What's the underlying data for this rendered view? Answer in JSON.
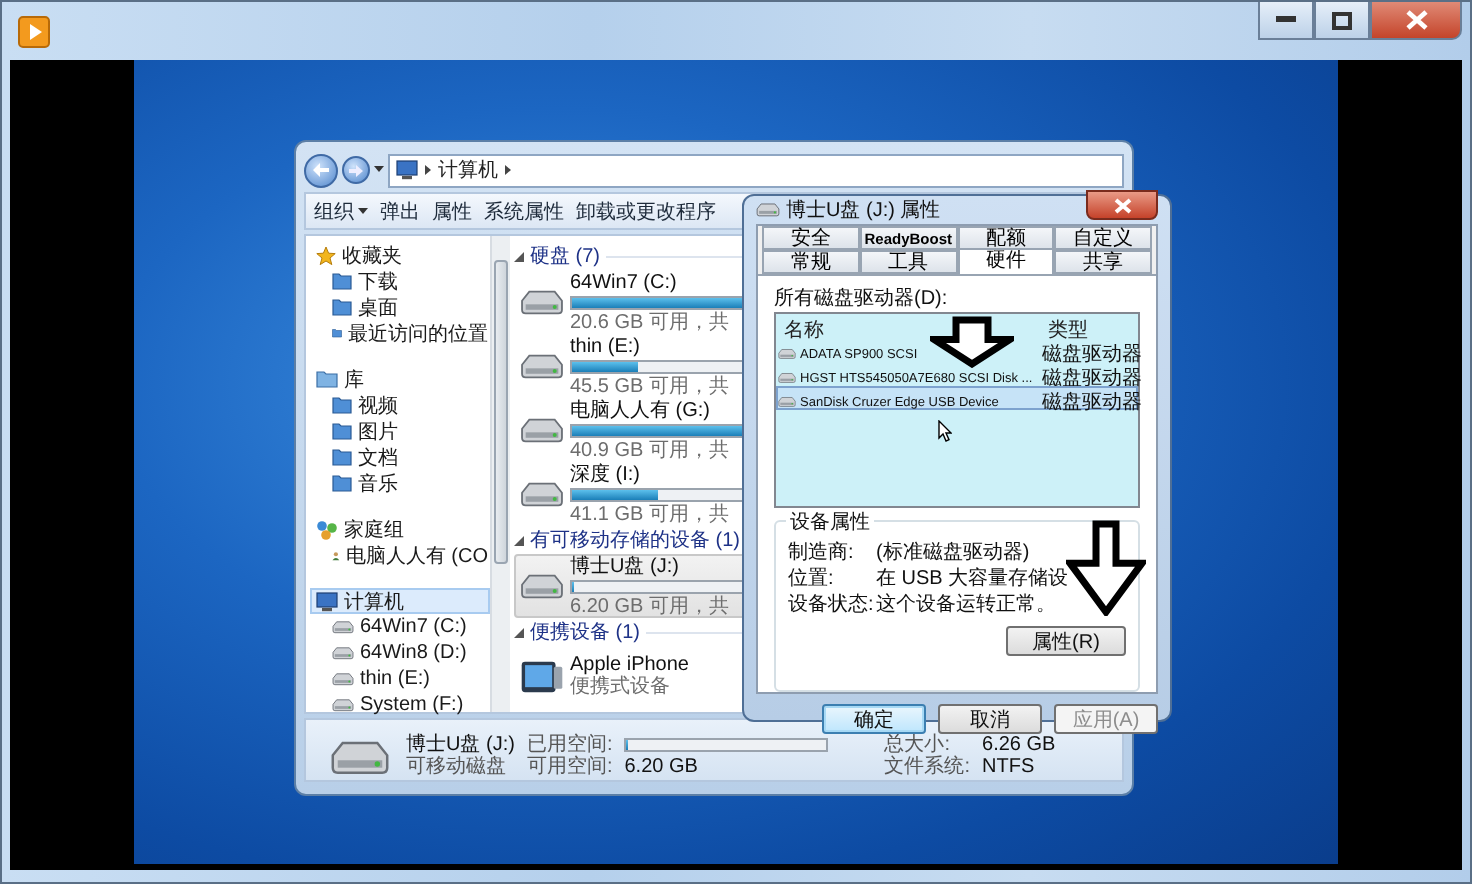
{
  "explorer": {
    "breadcrumb": "计算机",
    "toolbar": [
      {
        "label": "组织",
        "dropdown": true
      },
      {
        "label": "弹出",
        "dropdown": false
      },
      {
        "label": "属性",
        "dropdown": false
      },
      {
        "label": "系统属性",
        "dropdown": false
      },
      {
        "label": "卸载或更改程序",
        "dropdown": false
      }
    ],
    "nav": [
      {
        "label": "收藏夹",
        "selected": false,
        "children": [
          {
            "label": "下载",
            "selected": false
          },
          {
            "label": "桌面",
            "selected": false
          },
          {
            "label": "最近访问的位置",
            "selected": false
          }
        ]
      },
      {
        "label": "库",
        "selected": false,
        "children": [
          {
            "label": "视频",
            "selected": false
          },
          {
            "label": "图片",
            "selected": false
          },
          {
            "label": "文档",
            "selected": false
          },
          {
            "label": "音乐",
            "selected": false
          }
        ]
      },
      {
        "label": "家庭组",
        "selected": false,
        "children": [
          {
            "label": "电脑人人有 (CO",
            "selected": false
          }
        ]
      },
      {
        "label": "计算机",
        "selected": true,
        "children": [
          {
            "label": "64Win7 (C:)",
            "selected": false
          },
          {
            "label": "64Win8 (D:)",
            "selected": false
          },
          {
            "label": "thin (E:)",
            "selected": false
          },
          {
            "label": "System (F:)",
            "selected": false
          }
        ]
      }
    ],
    "groups": [
      {
        "title": "硬盘 (7)",
        "items": [
          {
            "kind": "drive",
            "name": "64Win7 (C:)",
            "level": 0.73,
            "info": "20.6 GB 可用，共",
            "selected": false
          },
          {
            "kind": "drive",
            "name": "thin (E:)",
            "level": 0.25,
            "info": "45.5 GB 可用，共",
            "selected": false
          },
          {
            "kind": "drive",
            "name": "电脑人人有 (G:)",
            "level": 0.66,
            "info": "40.9 GB 可用，共",
            "selected": false
          },
          {
            "kind": "drive",
            "name": "深度 (I:)",
            "level": 0.33,
            "info": "41.1 GB 可用，共",
            "selected": false
          }
        ]
      },
      {
        "title": "有可移动存储的设备 (1)",
        "items": [
          {
            "kind": "drive",
            "name": "博士U盘 (J:)",
            "level": 0.01,
            "info": "6.20 GB 可用，共",
            "selected": true
          }
        ]
      },
      {
        "title": "便携设备 (1)",
        "items": [
          {
            "kind": "device",
            "name": "Apple iPhone",
            "info": "便携式设备",
            "selected": false
          }
        ]
      }
    ],
    "details": {
      "name": "博士U盘 (J:)",
      "type": "可移动磁盘",
      "used": {
        "label": "已用空间:",
        "level": 0.01
      },
      "free_label": "可用空间:",
      "free_value": "6.20 GB",
      "total_label": "总大小:",
      "total_value": "6.26 GB",
      "fs_label": "文件系统:",
      "fs_value": "NTFS"
    }
  },
  "dialog": {
    "title": "博士U盘 (J:) 属性",
    "tab_rows": [
      [
        {
          "label": "安全",
          "selected": false
        },
        {
          "label": "ReadyBoost",
          "selected": false
        },
        {
          "label": "配额",
          "selected": false
        },
        {
          "label": "自定义",
          "selected": false
        }
      ],
      [
        {
          "label": "常规",
          "selected": false
        },
        {
          "label": "工具",
          "selected": false
        },
        {
          "label": "硬件",
          "selected": true
        },
        {
          "label": "共享",
          "selected": false
        }
      ]
    ],
    "list_label": "所有磁盘驱动器(D):",
    "columns": [
      "名称",
      "类型"
    ],
    "rows": [
      {
        "name": "ADATA SP900 SCSI",
        "type": "磁盘驱动器",
        "selected": false
      },
      {
        "name": "HGST HTS545050A7E680 SCSI Disk ...",
        "type": "磁盘驱动器",
        "selected": false
      },
      {
        "name": "SanDisk Cruzer Edge USB Device",
        "type": "磁盘驱动器",
        "selected": true
      }
    ],
    "properties_title": "设备属性",
    "properties": [
      {
        "label": "制造商:",
        "value": "(标准磁盘驱动器)"
      },
      {
        "label": "位置:",
        "value": "在 USB 大容量存储设"
      },
      {
        "label": "设备状态:",
        "value": "这个设备运转正常。"
      }
    ],
    "properties_button": "属性(R)",
    "buttons": [
      {
        "label": "确定",
        "default": true,
        "disabled": false
      },
      {
        "label": "取消",
        "default": false,
        "disabled": false
      },
      {
        "label": "应用(A)",
        "default": false,
        "disabled": true
      }
    ]
  }
}
